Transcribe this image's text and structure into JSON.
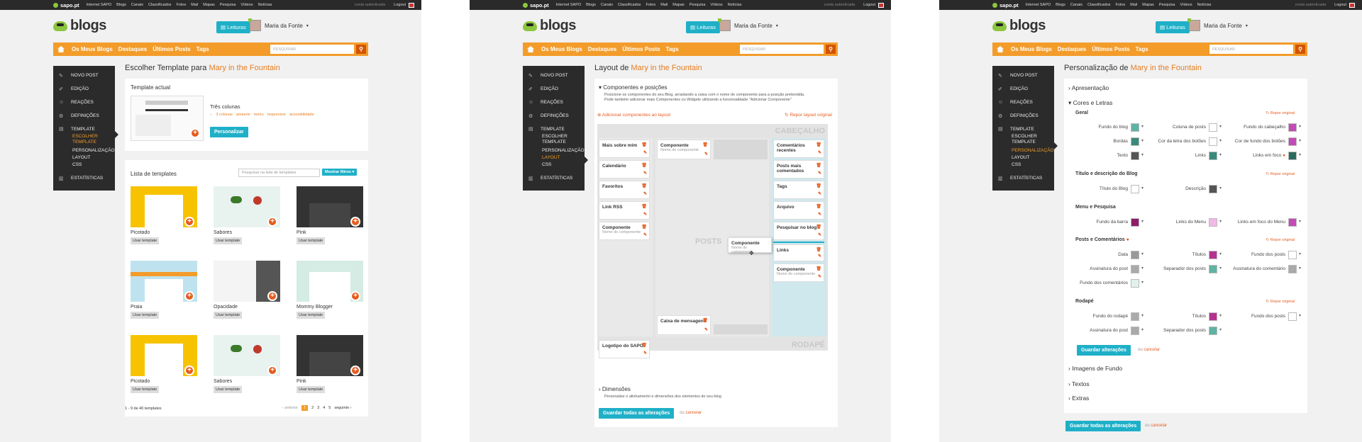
{
  "topbar": {
    "brand": "sapo.pt",
    "items": [
      "Internet SAPO",
      "Blogs",
      "Canais",
      "Classificados",
      "Fotos",
      "Mail",
      "Mapas",
      "Pesquisa",
      "Vídeos",
      "Notícias"
    ],
    "auth": "conta autenticada",
    "logout": "Logout"
  },
  "header": {
    "logo": "blogs",
    "leituras": "Leituras",
    "user": "Maria da Fonte",
    "search_placeholder": "PESQUISAR"
  },
  "nav": [
    "Os Meus Blogs",
    "Destaques",
    "Últimos Posts",
    "Tags"
  ],
  "sidebar": {
    "items": [
      "NOVO POST",
      "EDIÇÃO",
      "REAÇÕES",
      "DEFINIÇÕES",
      "TEMPLATE",
      "ESTATÍSTICAS"
    ],
    "template_sub": [
      "ESCOLHER TEMPLATE",
      "PERSONALIZAÇÃO",
      "LAYOUT",
      "CSS"
    ]
  },
  "blog_name": "Mary in the Fountain",
  "p1": {
    "title": "Escolher Template para",
    "actual_label": "Template actual",
    "template_name": "Três colunas",
    "tags": [
      "3 colunas",
      "amarelo",
      "menu",
      "responsive",
      "acessibilidade"
    ],
    "personalize": "Personalizar",
    "list_label": "Lista de templates",
    "list_search": "Pesquisar na lista de templates",
    "filters": "Mostrar filtros",
    "templates": [
      "Picotado",
      "Sabores",
      "Pink",
      "Praia",
      "Opacidade",
      "Mommy Blogger",
      "Picotado",
      "Sabores",
      "Pink"
    ],
    "use": "Usar template",
    "count": "1 - 9 de 40 templates",
    "prev": "anterior",
    "pages": [
      "1",
      "2",
      "3",
      "4",
      "5"
    ],
    "next": "seguinte"
  },
  "p2": {
    "title": "Layout de",
    "section": "Componentes e posições",
    "desc1": "Posicione os componentes do seu Blog, arrastando a caixa com o nome do componente para a posição pretendida.",
    "desc2": "Pode também adicionar mais Componentes ou Widgets utilizando a funcionalidade \"Adicionar Componente\"",
    "add": "Adicionar componentes ao layout",
    "reset": "Repor layout original",
    "header_zone": "CABEÇALHO",
    "posts_zone": "POSTS",
    "footer_zone": "RODAPÉ",
    "left": [
      "Mais sobre mim",
      "Calendário",
      "Favoritos",
      "Link RSS",
      "Componente"
    ],
    "comp_sub": "Nome do componente",
    "mid_top": "Componente",
    "mid_bottom": "Caixa de mensagens",
    "right": [
      "Comentários recentes",
      "Posts mais comentados",
      "Tags",
      "Arquivo",
      "Pesquisar no blog",
      "Links",
      "Componente"
    ],
    "footer_comp": "Logotipo do SAPO",
    "dragging": "Componente",
    "dims": "Dimensões",
    "dims_desc": "Personalize o alinhamento e dimensões dos elementos do seu blog",
    "save": "Guardar todas as alterações",
    "or": "ou",
    "cancel": "cancelar"
  },
  "p3": {
    "title": "Personalização de",
    "apres": "Apresentação",
    "cores": "Cores e Letras",
    "reset": "Repor original",
    "sections": [
      "Geral",
      "Título e descrição do Blog",
      "Menu e Pesquisa",
      "Posts e Comentários",
      "Rodapé"
    ],
    "geral": [
      "Fundo do blog",
      "Coluna de posts",
      "Fundo do cabeçalho",
      "Bordas",
      "Cor da letra dos botões",
      "Cor de fundo dos botões",
      "Texto",
      "Links",
      "Links em foco"
    ],
    "titulo": [
      "Título do Blog",
      "Descrição"
    ],
    "menu": [
      "Fundo da barra",
      "Links do Menu",
      "Links em foco do Menu"
    ],
    "posts": [
      "Data",
      "Títulos",
      "Fundo dos posts",
      "Assinatura do post",
      "Separador dos posts",
      "Assinatura do comentário",
      "Fundo dos comentários"
    ],
    "rodape": [
      "Fundo do rodapé",
      "Títulos",
      "Fundo dos posts",
      "Assinatura do post",
      "Separador dos posts"
    ],
    "save_section": "Guardar alterações",
    "more": [
      "Imagens de Fundo",
      "Textos",
      "Extras"
    ],
    "save": "Guardar todas as alterações",
    "or": "ou",
    "cancel": "cancelar"
  },
  "colors": {
    "accent": "#f39c2a",
    "blue": "#1fb0c8",
    "dark": "#2b2b2b",
    "orange_text": "#e67e22"
  }
}
